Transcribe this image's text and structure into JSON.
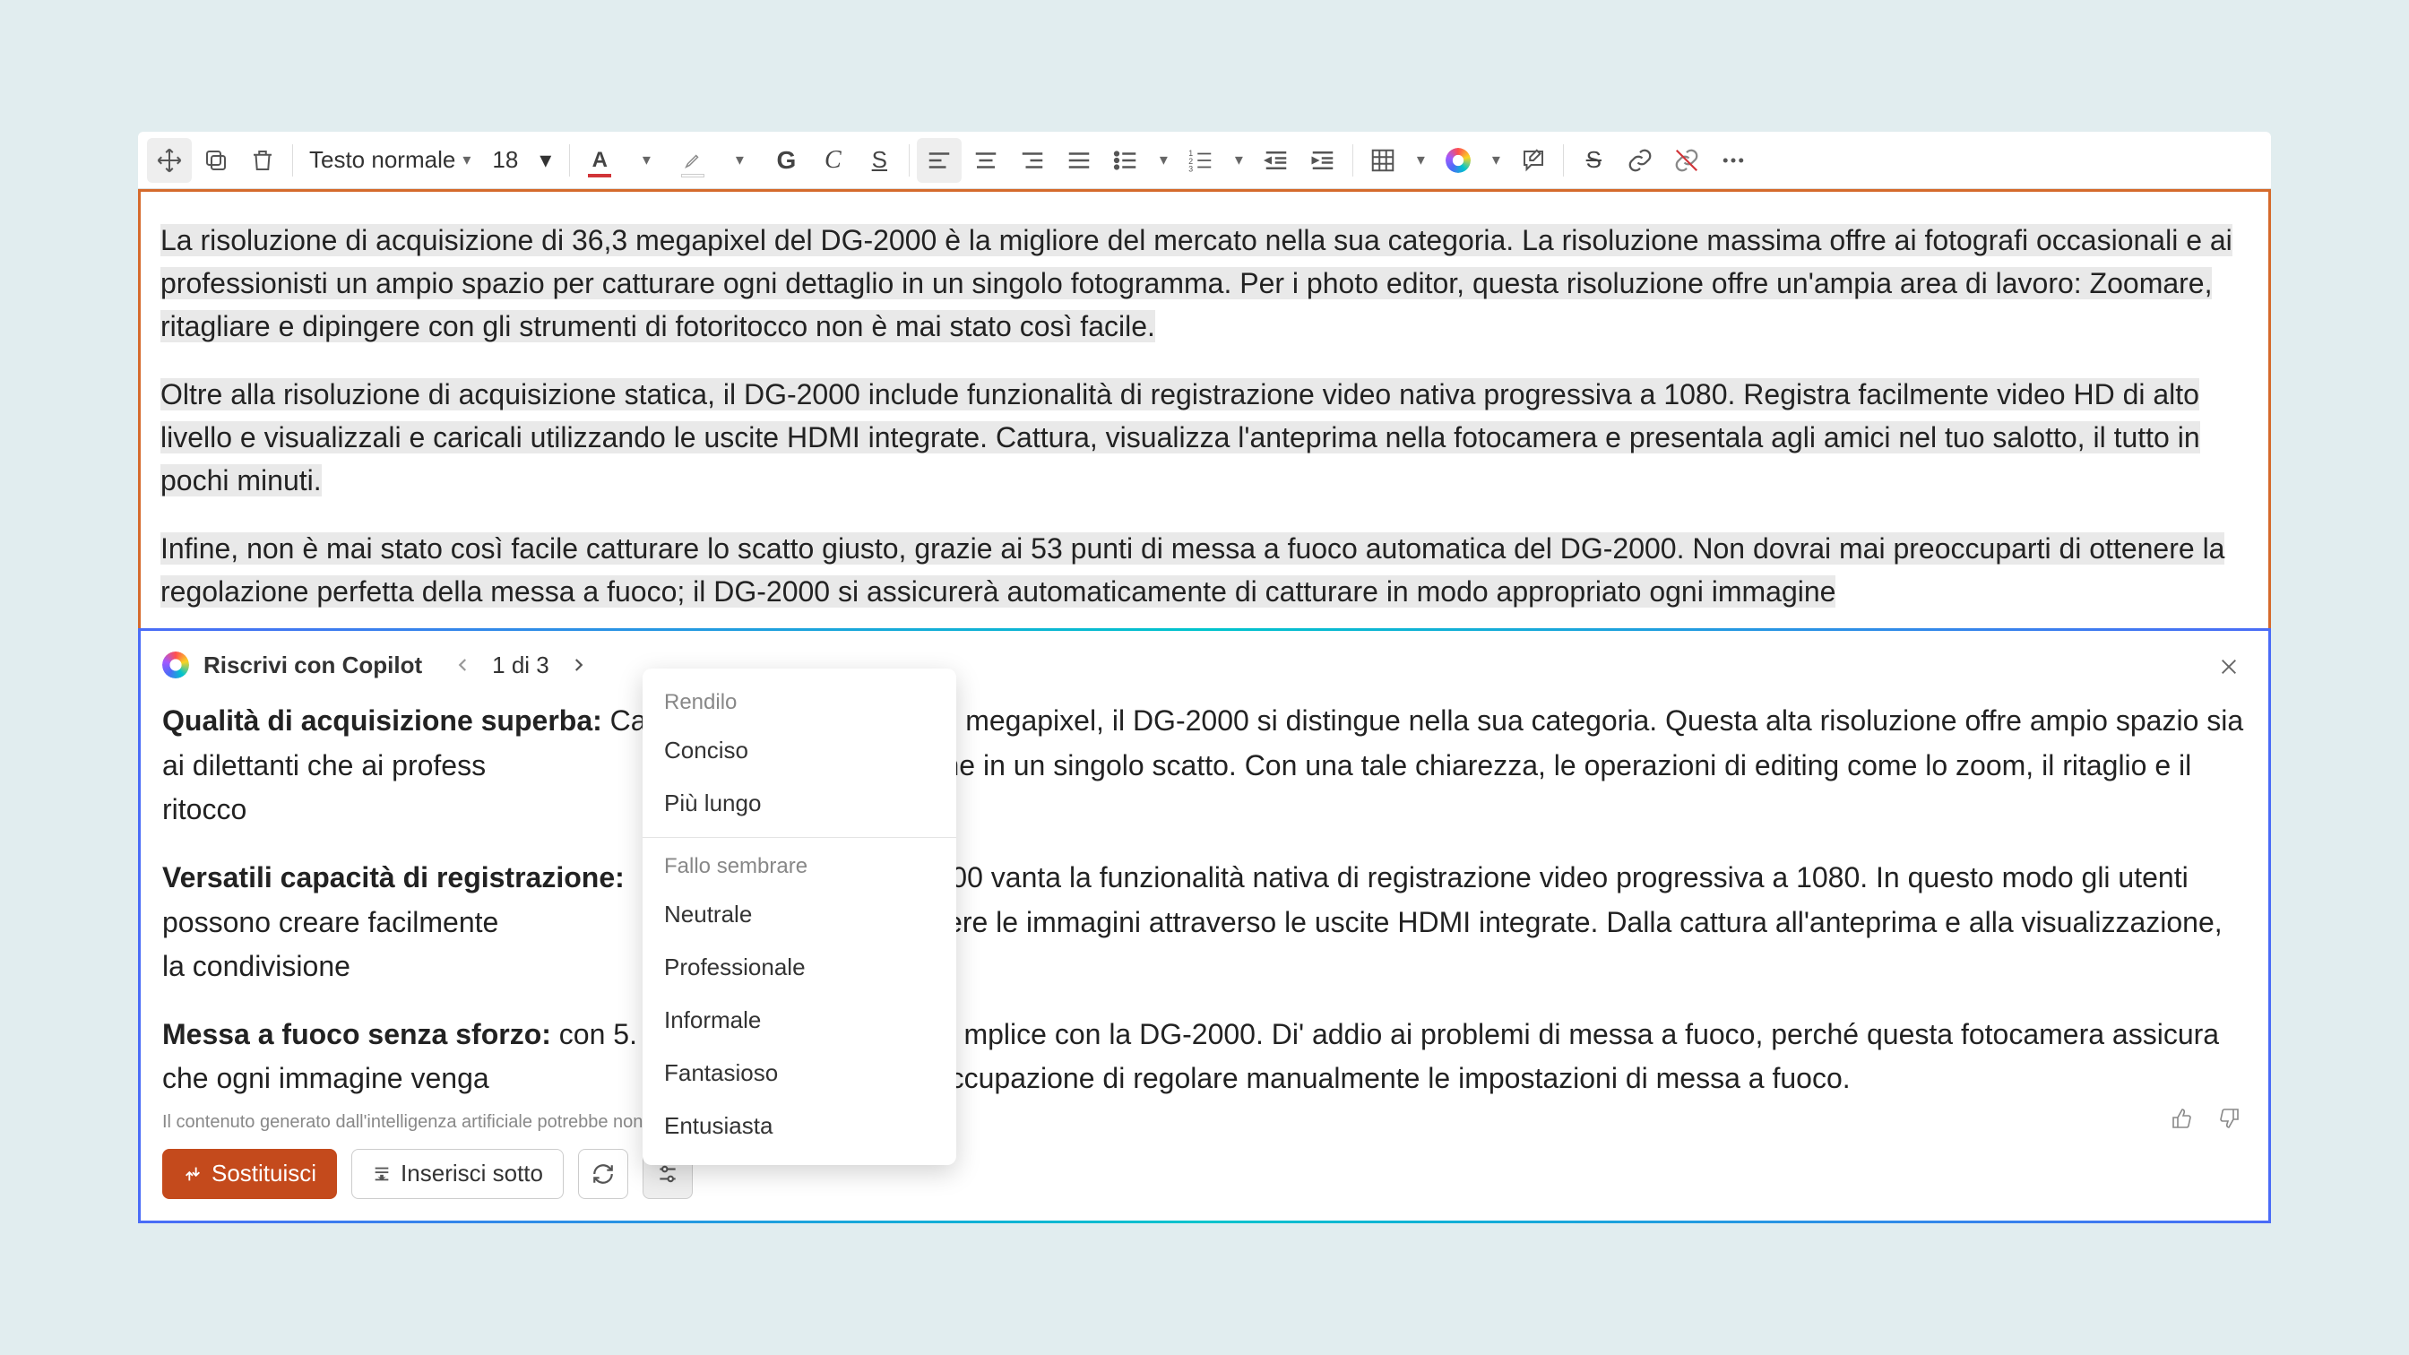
{
  "toolbar": {
    "style_label": "Testo normale",
    "font_size": "18"
  },
  "document": {
    "p1": "La risoluzione di acquisizione di 36,3 megapixel del DG-2000 è la migliore del mercato nella sua categoria. La risoluzione massima offre ai fotografi occasionali e ai professionisti un ampio spazio per catturare ogni dettaglio in un singolo fotogramma. Per i photo editor, questa risoluzione offre un'ampia area di lavoro: Zoomare, ritagliare e dipingere con gli strumenti di fotoritocco non è mai stato così facile.",
    "p2": "Oltre alla risoluzione di acquisizione statica, il DG-2000 include funzionalità di registrazione video nativa progressiva a 1080. Registra facilmente video HD di alto livello e visualizzali e caricali utilizzando le uscite HDMI integrate. Cattura, visualizza l'anteprima nella fotocamera e presentala agli amici nel tuo salotto, il tutto in pochi minuti.",
    "p3": "Infine, non è mai stato così facile catturare lo scatto giusto, grazie ai 53 punti di messa a fuoco automatica del DG-2000. Non dovrai mai preoccuparti di ottenere la regolazione perfetta della messa a fuoco; il DG-2000 si assicurerà automaticamente di catturare in modo appropriato ogni immagine"
  },
  "copilot": {
    "title": "Riscrivi con Copilot",
    "pager": "1 di 3",
    "s1_title": "Qualità di acquisizione superba:",
    "s1_body": " Ca                                        megapixel, il DG-2000 si distingue nella sua categoria. Questa alta risoluzione offre ampio spazio sia ai dilettanti che ai profess                                        on precisione in un singolo scatto. Con una tale chiarezza, le operazioni di editing come lo zoom, il ritaglio e il ritocco",
    "s2_title": "Versatili capacità di registrazione:",
    "s2_body": "                                         00 vanta la funzionalità nativa di registrazione video progressiva a 1080. In questo modo gli utenti possono creare facilmente                                        e condividere le immagini attraverso le uscite HDMI integrate. Dalla cattura all'anteprima e alla visualizzazione, la condivisione",
    "s3_title": "Messa a fuoco senza sforzo:",
    "s3_body": " con 5.                                         mplice con la DG-2000. Di' addio ai problemi di messa a fuoco, perché questa fotocamera assicura che ogni immagine venga                                          dalla preoccupazione di regolare manualmente le impostazioni di messa a fuoco.",
    "disclaimer": "Il contenuto generato dall'intelligenza artificiale potrebbe non e",
    "replace_label": "Sostituisci",
    "insert_label": "Inserisci sotto"
  },
  "tone_menu": {
    "header1": "Rendilo",
    "items1": [
      "Conciso",
      "Più lungo"
    ],
    "header2": "Fallo sembrare",
    "items2": [
      "Neutrale",
      "Professionale",
      "Informale",
      "Fantasioso",
      "Entusiasta"
    ]
  }
}
